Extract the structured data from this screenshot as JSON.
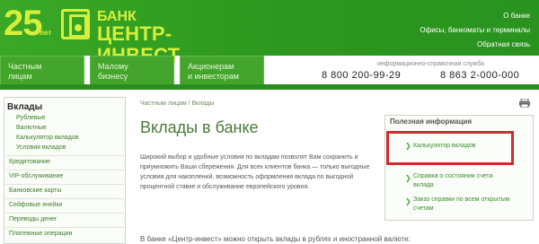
{
  "logo": {
    "number": "25",
    "years": "лет",
    "bank": "БАНК",
    "name": "ЦЕНТР-ИНВЕСТ"
  },
  "toplinks": [
    "О банке",
    "Офисы, банкоматы и терминалы",
    "Обратная связь"
  ],
  "tabs": [
    {
      "line1": "Частным",
      "line2": "лицам"
    },
    {
      "line1": "Малому",
      "line2": "бизнесу"
    },
    {
      "line1": "Акционерам",
      "line2": "и инвесторам"
    }
  ],
  "phones": {
    "caption": "информационно-справочная служба",
    "phone1": "8 800 200-99-29",
    "phone2": "8 863 2-000-000"
  },
  "sidebar": {
    "title": "Вклады",
    "items": [
      "Рублевые",
      "Валютные",
      "Калькулятор вкладов",
      "Условия вкладов",
      "Кредитование",
      "VIP-обслуживание",
      "Банковские карты",
      "Сейфовые ячейки",
      "Переводы денег",
      "Платежные операции"
    ]
  },
  "breadcrumb": "Частным лицам / Вклады",
  "title": "Вклады в банке",
  "intro": "Широкий выбор и удобные условия по вкладам позволят Вам сохранить и приумножить Ваши сбережения. Для всех клиентов банка — только выгодные условия для накоплений, возможность оформления вклада по выгодной процентной ставке и обслуживание европейского уровня.",
  "bottom_text": "В банке «Центр-инвест» можно открыть вклады в рублях и иностранной валюте:",
  "info": {
    "title": "Полезная информация",
    "links": [
      "Калькулятор вкладов",
      "Справка о состоянии счета вклада",
      "Заказ справки по всем открытым счетам"
    ]
  }
}
